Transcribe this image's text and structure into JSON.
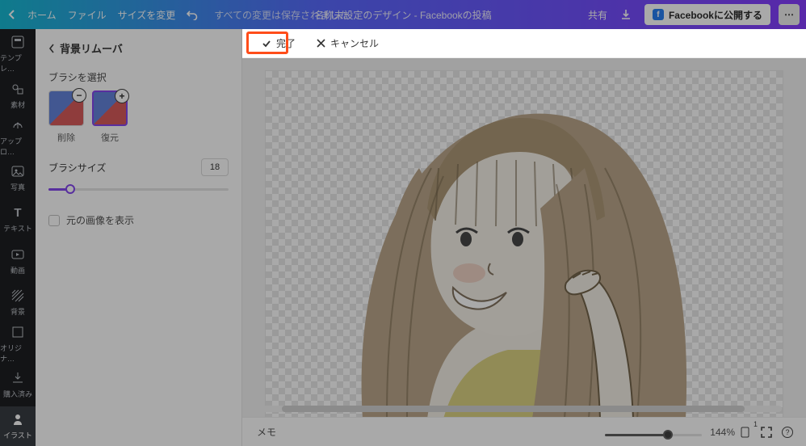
{
  "topbar": {
    "home": "ホーム",
    "file": "ファイル",
    "resize": "サイズを変更",
    "saved": "すべての変更は保存されました",
    "title": "名称未設定のデザイン - Facebookの投稿",
    "share": "共有",
    "publish": "Facebookに公開する"
  },
  "rail": [
    {
      "key": "template",
      "label": "テンプレ…"
    },
    {
      "key": "elements",
      "label": "素材"
    },
    {
      "key": "upload",
      "label": "アップロ…"
    },
    {
      "key": "photo",
      "label": "写真"
    },
    {
      "key": "text",
      "label": "テキスト"
    },
    {
      "key": "video",
      "label": "動画"
    },
    {
      "key": "bg",
      "label": "背景"
    },
    {
      "key": "original",
      "label": "オリジナ…"
    },
    {
      "key": "purchased",
      "label": "購入済み"
    },
    {
      "key": "illust",
      "label": "イラスト"
    }
  ],
  "panel": {
    "title": "背景リムーバ",
    "brush_select": "ブラシを選択",
    "brush_erase": "削除",
    "brush_restore": "復元",
    "brush_size_label": "ブラシサイズ",
    "brush_size_value": "18",
    "show_original": "元の画像を表示"
  },
  "chead": {
    "done": "完了",
    "cancel": "キャンセル"
  },
  "footer": {
    "notes": "メモ",
    "zoom": "144%",
    "pages": "1"
  }
}
